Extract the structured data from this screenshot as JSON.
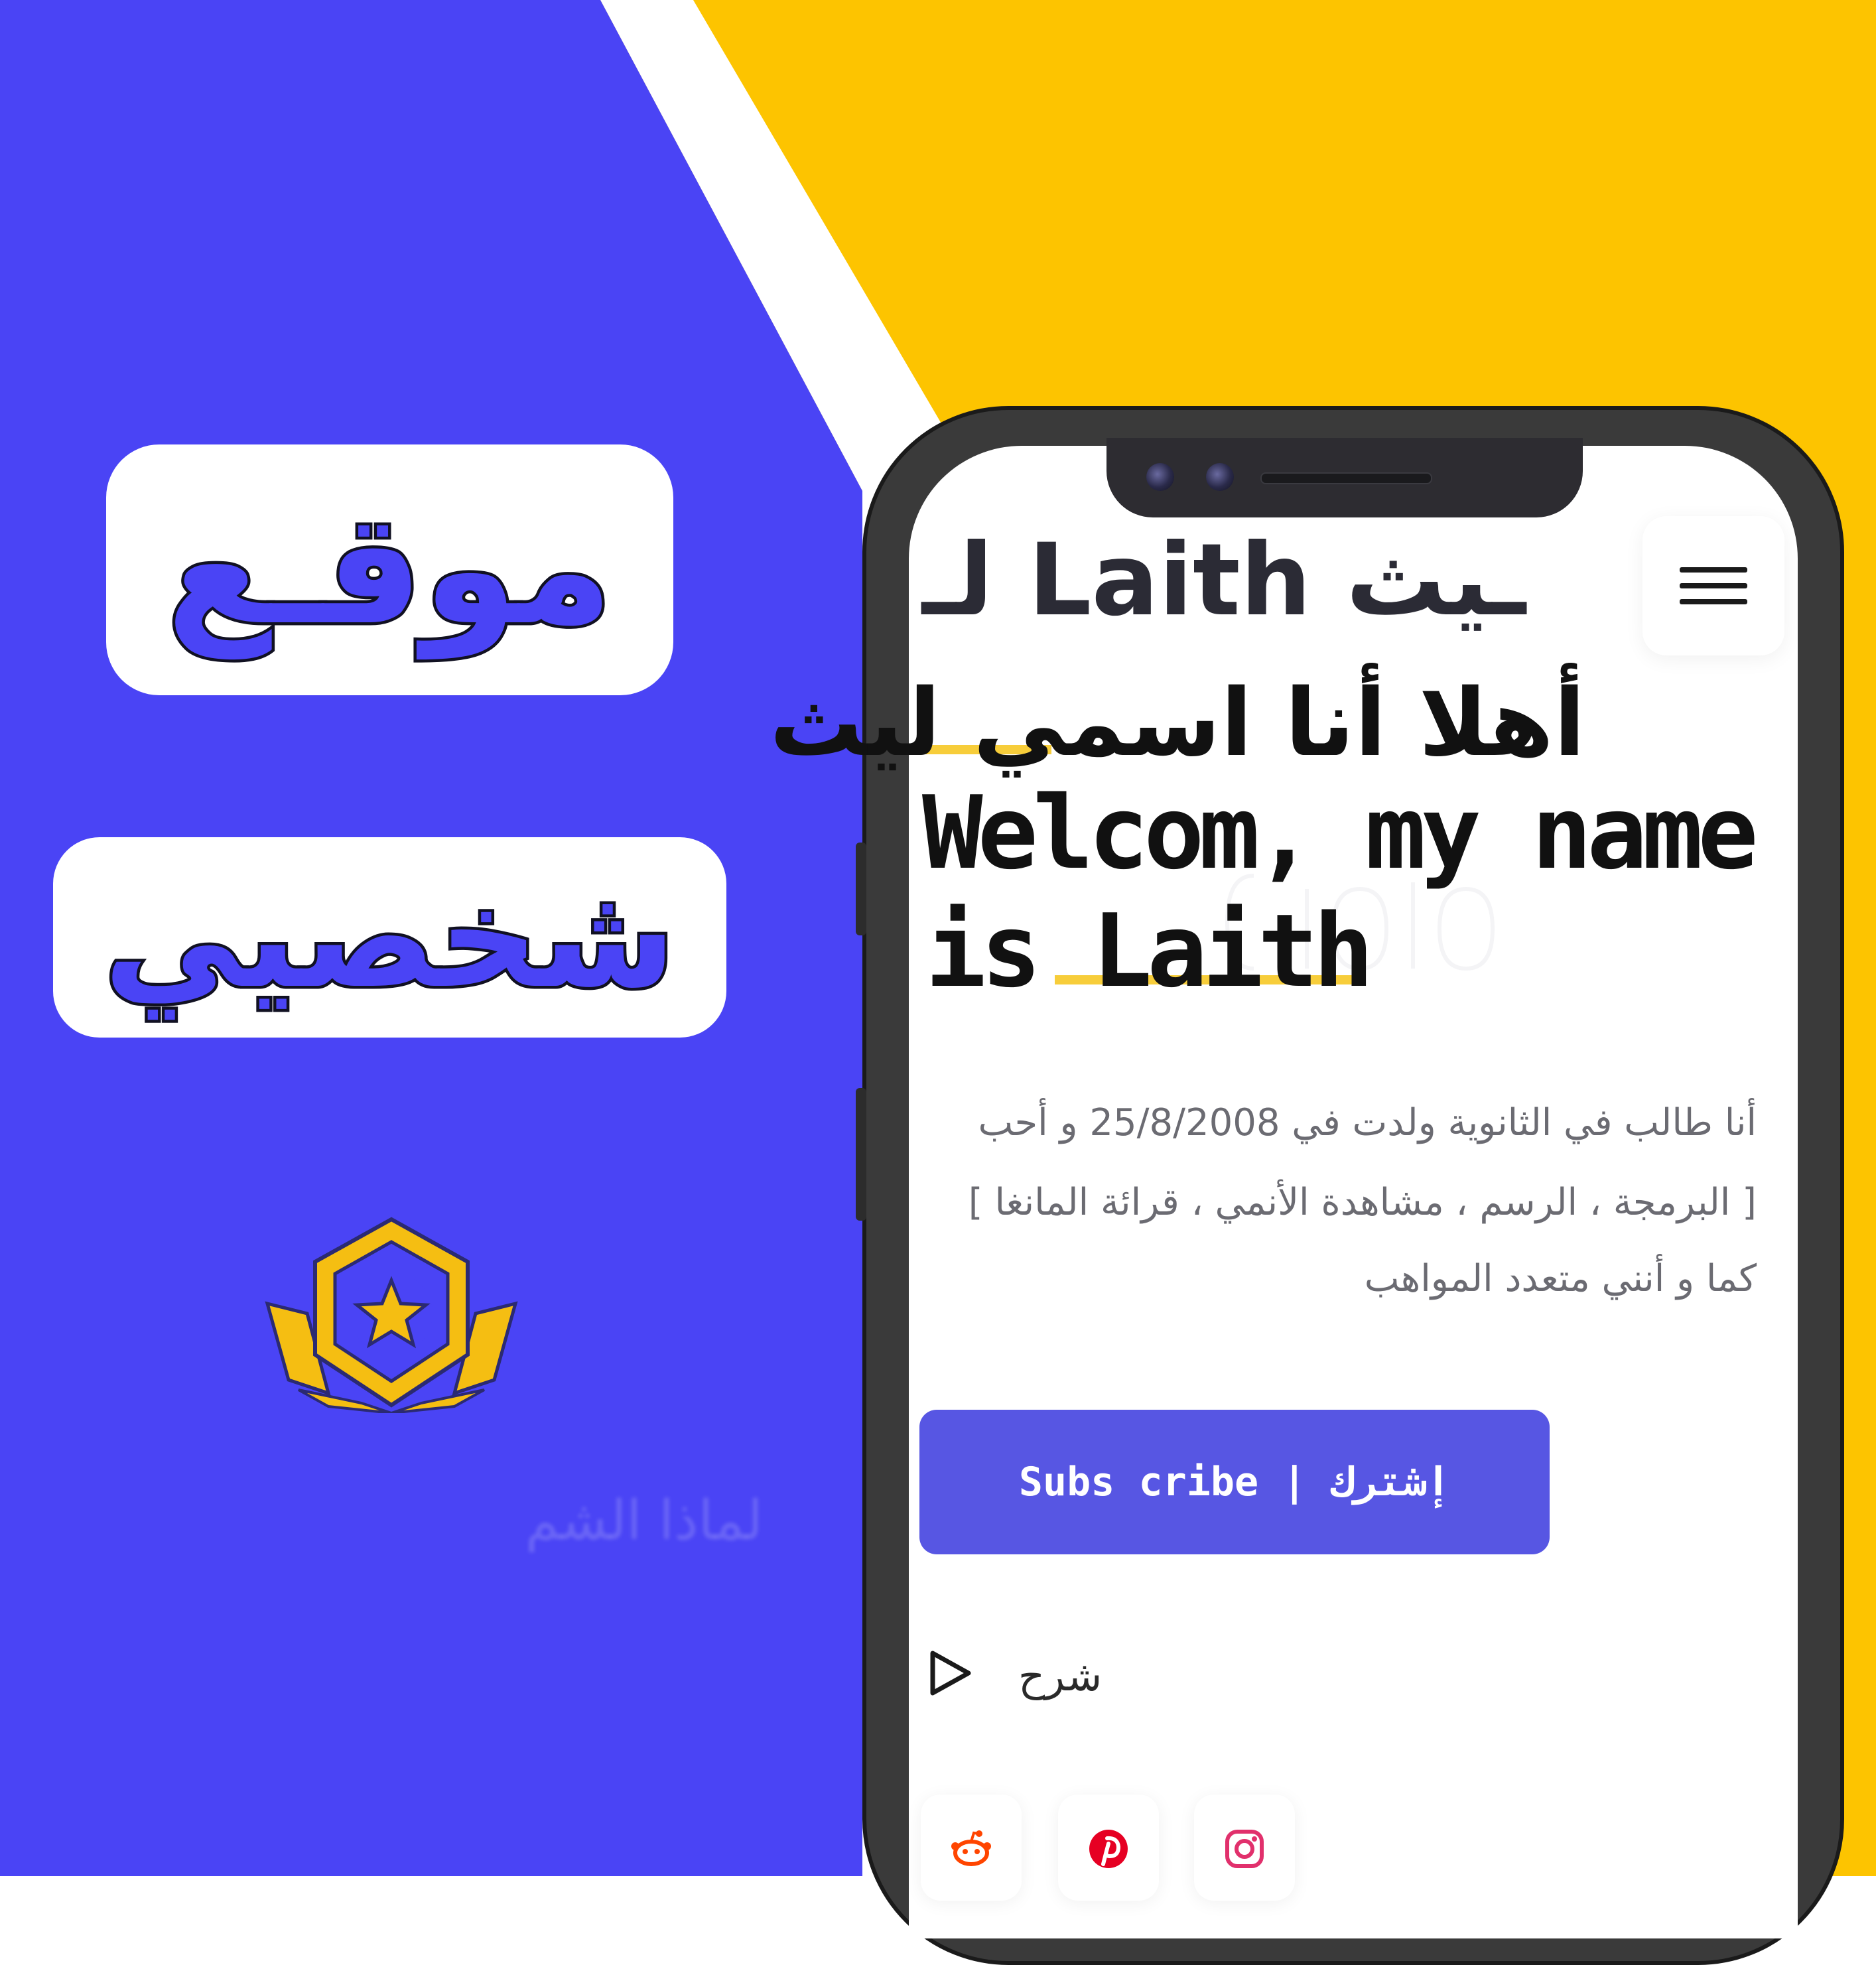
{
  "colors": {
    "left_background": "#4a44f5",
    "right_background": "#fdc400",
    "accent_button": "#5756e3",
    "highlight": "#f7cd3a"
  },
  "poster": {
    "title_line_1": "موقـع",
    "title_line_2": "شخصيي",
    "badge_icon": "star-hexagon-badge-icon",
    "faded_caption": "لماذا الشم"
  },
  "site": {
    "logo": "لـ Laith ـيث",
    "menu_icon": "hamburger-menu-icon",
    "heading_ar": "أهلا أنا اسمي ليث",
    "heading_en_line_1": "Welcom, my name",
    "heading_en_line_2": "is Laith",
    "bio": [
      "أنا طالب في الثانوية ولدت في 25/8/2008 و أحب",
      "[ البرمجة ، الرسم ، مشاهدة الأنمي ، قرائة المانغا ]",
      "كما و أنني متعدد المواهب"
    ],
    "subscribe_label": "Subs cribe | إشترك",
    "explain_icon": "play-icon",
    "explain_label": "شرح",
    "social": [
      "reddit-icon",
      "pinterest-icon",
      "instagram-icon"
    ]
  }
}
